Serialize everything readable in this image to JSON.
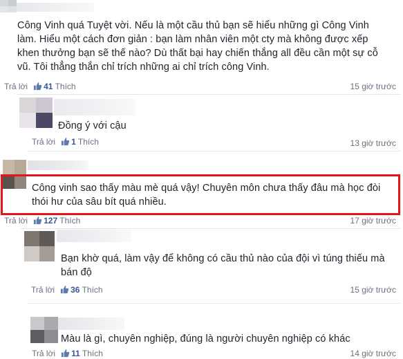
{
  "comments": [
    {
      "text": "Công Vinh quá Tuyệt vời. Nếu là một cầu thủ bạn sẽ hiểu những gì Công Vinh làm. Hiểu một cách đơn giản : bạn làm nhân viên một cty mà không được xếp khen thưởng bạn sẽ thế nào? Dù thất bại hay chiến thắng all đều cần một sự cỗ vũ. Tôi thẳng thắn chỉ trích những ai chỉ trích công Vinh.",
      "reply_label": "Trả lời",
      "like_count": "41",
      "like_label": "Thích",
      "time": "15 giờ trước"
    },
    {
      "text": "Đồng ý với cậu",
      "reply_label": "Trả lời",
      "like_count": "1",
      "like_label": "Thích",
      "time": "13 giờ trước"
    },
    {
      "text": "Công vinh sao thấy màu mè quá vậy! Chuyên môn chưa thấy đâu mà học đòi thói hư của sâu bít quá nhiều.",
      "reply_label": "Trả lời",
      "like_count": "127",
      "like_label": "Thích",
      "time": "17 giờ trước"
    },
    {
      "text": "Bạn khờ quá, làm vậy để không có cầu thủ nào của đội vì túng thiếu mà bán độ",
      "reply_label": "Trả lời",
      "like_count": "36",
      "like_label": "Thích",
      "time": "15 giờ trước"
    },
    {
      "text": "Màu là gì, chuyên nghiệp, đúng là người chuyên nghiệp có khác",
      "reply_label": "Trả lời",
      "like_count": "11",
      "like_label": "Thích",
      "time": "14 giờ trước"
    }
  ],
  "colors": {
    "highlight_border": "#e4161b",
    "like_count": "#365899",
    "meta_text": "#6a7080"
  },
  "icons": {
    "like": "thumbs-up-icon",
    "avatar": "blurred-avatar"
  }
}
